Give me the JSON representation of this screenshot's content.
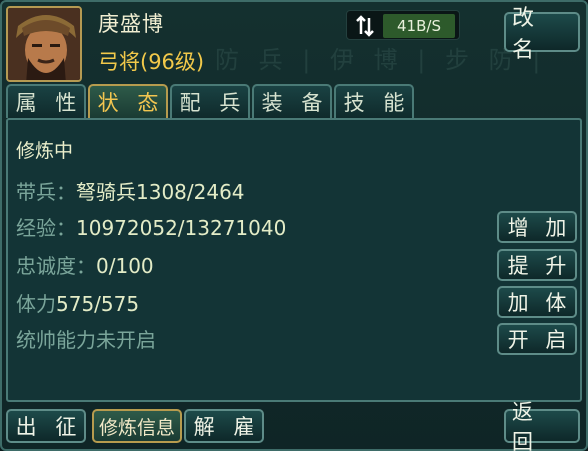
{
  "header": {
    "name": "庚盛博",
    "rank": "弓将(96级)",
    "rename_label": "改 名",
    "ghost_text": "防 兵 | 伊 博 | 步 防 |"
  },
  "network": {
    "speed": "41B/S"
  },
  "tabs": [
    {
      "label": "属 性"
    },
    {
      "label": "状 态"
    },
    {
      "label": "配 兵"
    },
    {
      "label": "装 备"
    },
    {
      "label": "技 能"
    }
  ],
  "status": {
    "title": "修炼中",
    "troops_label": "带兵：",
    "troops_value": "弩骑兵1308/2464",
    "exp_label": "经验：",
    "exp_value": "10972052/13271040",
    "loyalty_label": "忠诚度：",
    "loyalty_value": "0/100",
    "stamina_label": "体力",
    "stamina_value": "575/575",
    "command_text": "统帅能力未开启"
  },
  "side_buttons": {
    "increase": "增 加",
    "promote": "提 升",
    "stamina": "加 体",
    "unlock": "开 启"
  },
  "bottom": {
    "deploy": "出 征",
    "train_info": "修炼信息",
    "dismiss": "解 雇",
    "back": "返 回"
  },
  "colors": {
    "accent_gold": "#f2c94a",
    "panel": "#133436",
    "button_border": "#5e8c88"
  }
}
